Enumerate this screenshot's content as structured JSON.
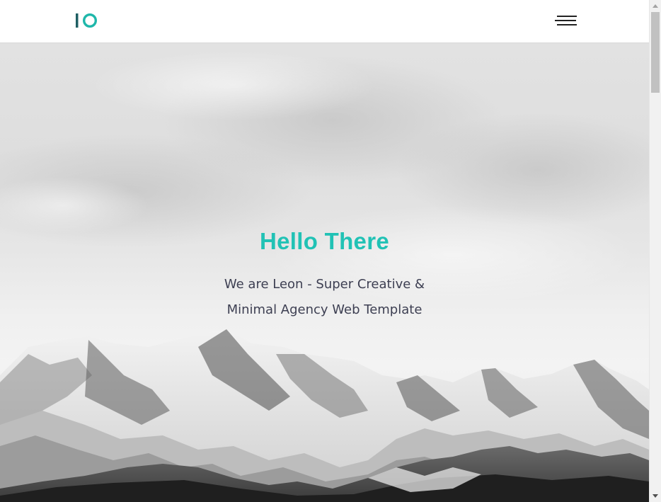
{
  "header": {
    "logo_text": "IO",
    "logo_color": "#1fb7aa",
    "logo_bar_color": "#1f5f63",
    "menu_icon": "hamburger-menu-icon"
  },
  "hero": {
    "title": "Hello There",
    "subtitle": "We are Leon - Super Creative & Minimal Agency Web Template",
    "title_color": "#21c2b5",
    "subtitle_color": "#3d3f52",
    "background": "grayscale snowy mountain range under cloudy sky"
  },
  "scrollbar": {
    "up_icon": "scroll-up-arrow-icon",
    "down_icon": "scroll-down-arrow-icon"
  }
}
